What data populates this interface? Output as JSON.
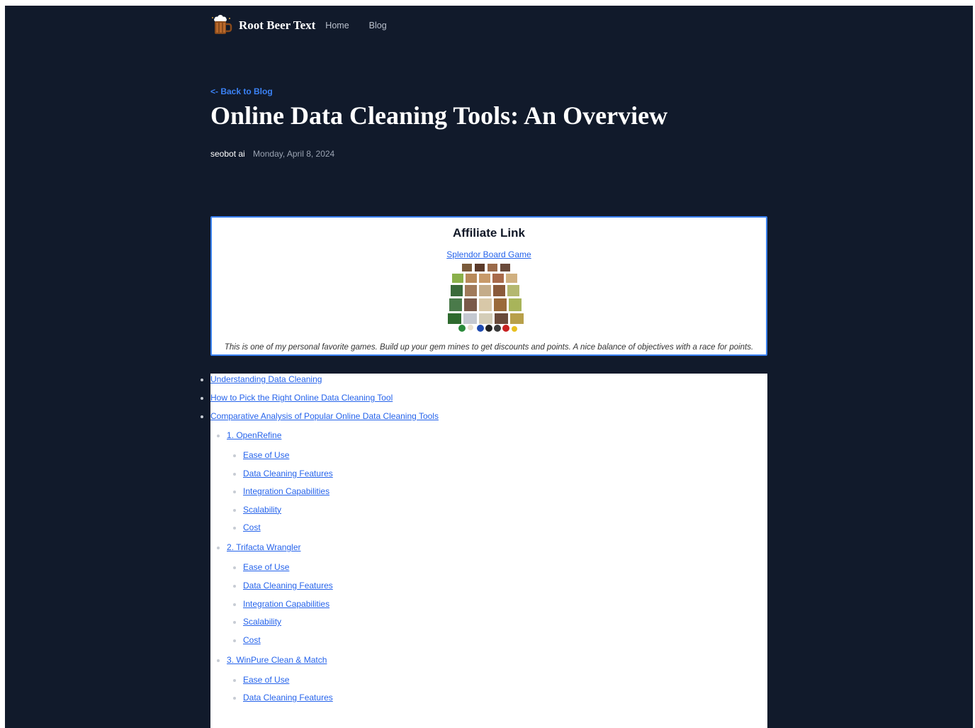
{
  "header": {
    "site_name": "Root Beer Text",
    "nav": [
      "Home",
      "Blog"
    ],
    "logo_icon": "root-beer-mug-icon"
  },
  "post": {
    "back_link": "<- Back to Blog",
    "title": "Online Data Cleaning Tools: An Overview",
    "author": "seobot ai",
    "date": "Monday, April 8, 2024"
  },
  "affiliate": {
    "heading": "Affiliate Link",
    "product": "Splendor Board Game",
    "description": "This is one of my personal favorite games. Build up your gem mines to get discounts and points. A nice balance of objectives with a race for points."
  },
  "toc": {
    "items": [
      "Understanding Data Cleaning",
      "How to Pick the Right Online Data Cleaning Tool",
      "Comparative Analysis of Popular Online Data Cleaning Tools"
    ],
    "tools": [
      {
        "name": "1. OpenRefine",
        "sub": [
          "Ease of Use",
          "Data Cleaning Features",
          "Integration Capabilities",
          "Scalability",
          "Cost"
        ]
      },
      {
        "name": "2. Trifacta Wrangler",
        "sub": [
          "Ease of Use",
          "Data Cleaning Features",
          "Integration Capabilities",
          "Scalability",
          "Cost"
        ]
      },
      {
        "name": "3. WinPure Clean & Match",
        "sub": [
          "Ease of Use",
          "Data Cleaning Features"
        ]
      }
    ]
  },
  "colors": {
    "page_bg": "#111a2b",
    "accent": "#3b82f6",
    "link": "#2563eb"
  }
}
